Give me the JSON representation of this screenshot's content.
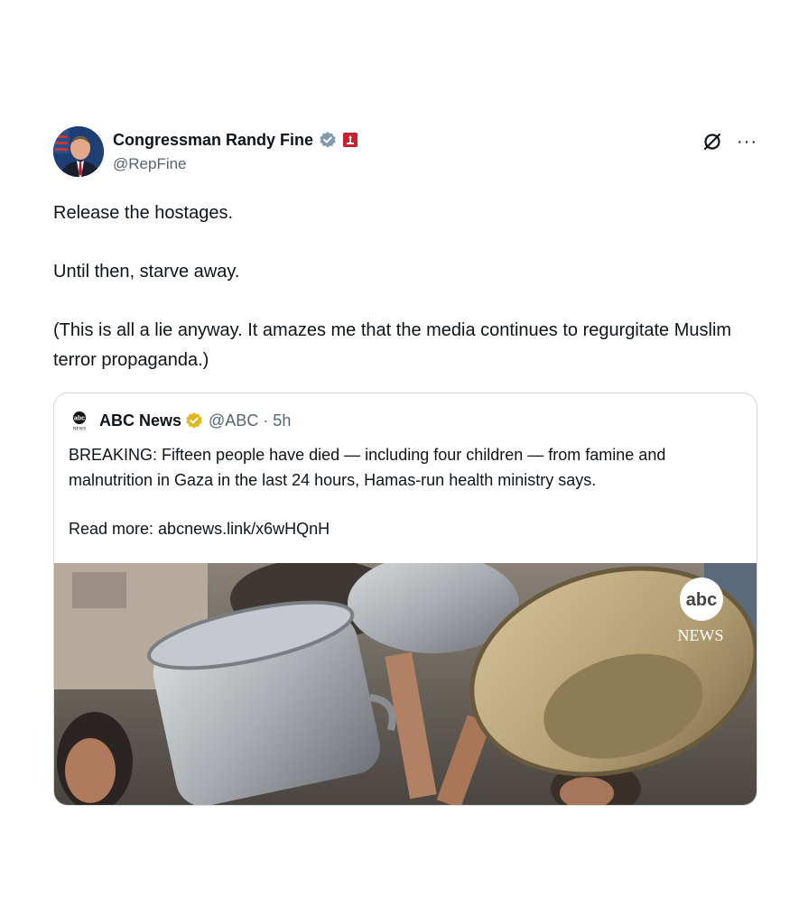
{
  "author": {
    "display_name": "Congressman Randy Fine",
    "handle": "@RepFine"
  },
  "tweet": {
    "lines": [
      "Release the hostages.",
      "Until then, starve away.",
      "(This is all a lie anyway.  It amazes me that the media continues to regurgitate Muslim terror propaganda.)"
    ]
  },
  "quote": {
    "display_name": "ABC News",
    "handle_time": "@ABC · 5h",
    "text_lines": [
      "BREAKING: Fifteen people have died — including four children — from famine and malnutrition in Gaza in the last 24 hours, Hamas-run health ministry says.",
      "Read more: abcnews.link/x6wHQnH"
    ],
    "image_watermark_line1": "abc",
    "image_watermark_line2": "NEWS"
  },
  "icons": {
    "verified": "verified-badge-icon",
    "affiliation": "affiliation-badge-icon",
    "grok": "grok-icon",
    "more": "more-icon"
  },
  "colors": {
    "text": "#0f1419",
    "secondary": "#536471",
    "verified_blue": "#829aab",
    "gold_badge": "#e2b719",
    "affiliation_red": "#c8202f",
    "border": "#cfd9de"
  }
}
